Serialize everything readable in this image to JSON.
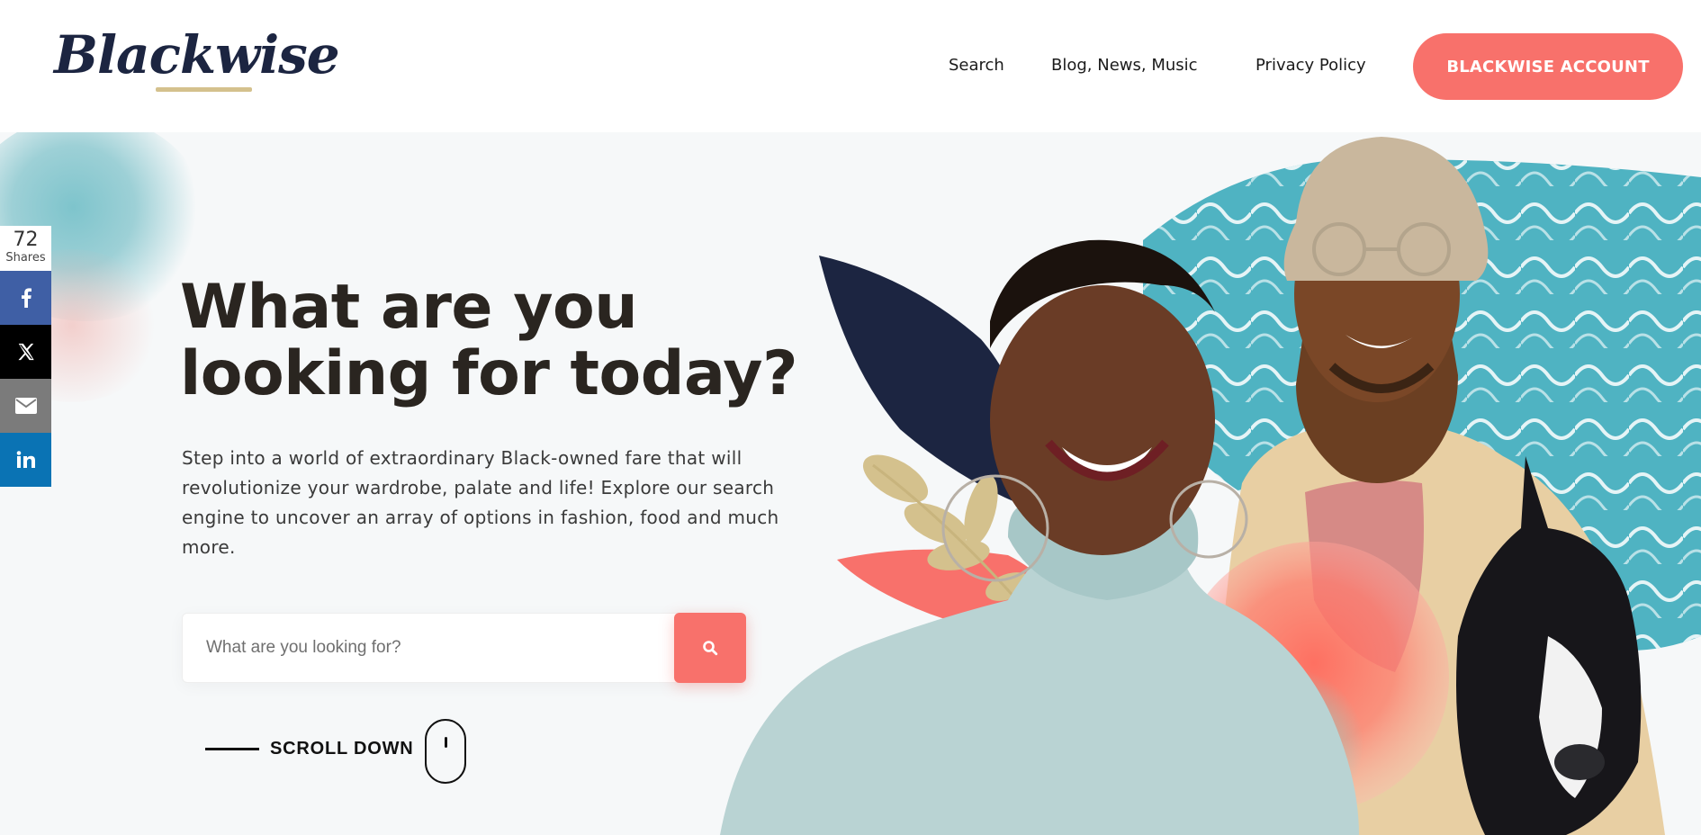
{
  "header": {
    "logo_text": "Blackwise",
    "nav": [
      {
        "label": "Search"
      },
      {
        "label": "Blog, News, Music"
      },
      {
        "label": "Privacy Policy"
      }
    ],
    "account_button": "BLACKWISE ACCOUNT"
  },
  "hero": {
    "headline_line1": "What are you",
    "headline_line2": "looking for today?",
    "description": "Step into a world of extraordinary Black-owned fare that will revolutionize your wardrobe, palate and life! Explore our search engine to uncover an array of options in fashion, food and much more.",
    "search": {
      "placeholder": "What are you looking for?",
      "value": "",
      "button_icon": "search-icon"
    },
    "scroll_label": "SCROLL DOWN"
  },
  "share_bar": {
    "count": "72",
    "count_label": "Shares",
    "buttons": [
      {
        "icon": "facebook-icon",
        "color": "#3f5fa5"
      },
      {
        "icon": "x-icon",
        "color": "#000000"
      },
      {
        "icon": "email-icon",
        "color": "#7b7b7b"
      },
      {
        "icon": "linkedin-icon",
        "color": "#0a73b4"
      }
    ]
  },
  "colors": {
    "accent": "#f8716b",
    "logo": "#1c2541",
    "logo_underline": "#d4c18d",
    "heading": "#2a2520",
    "teal": "#4fb3c2"
  }
}
